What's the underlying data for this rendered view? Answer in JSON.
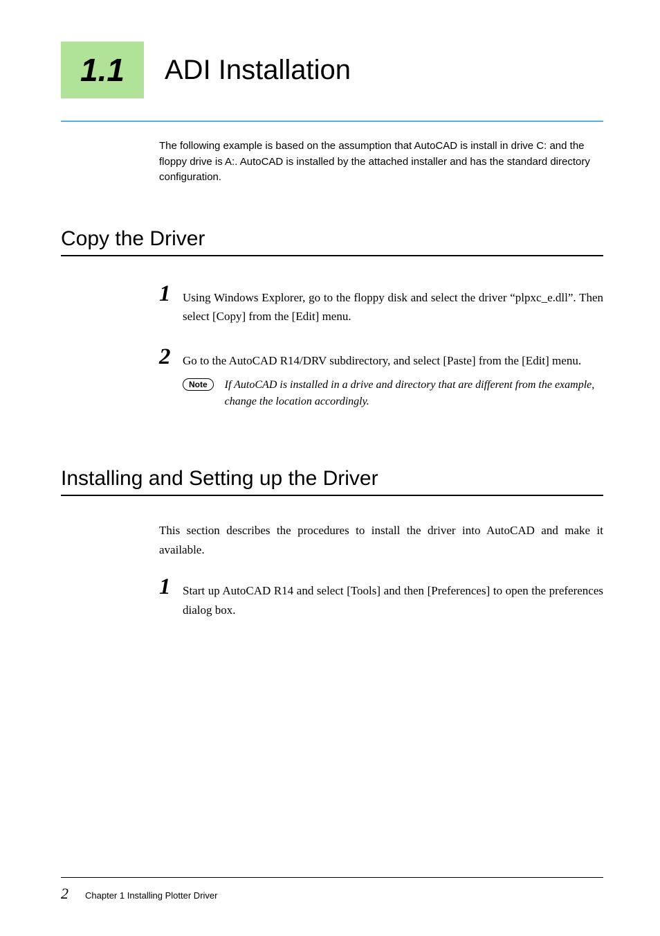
{
  "section_number": "1.1",
  "page_title": "ADI Installation",
  "intro": "The following example is based on the assumption that AutoCAD is install in drive C: and the floppy drive is A:. AutoCAD is installed by the attached installer and has the standard directory configuration.",
  "copy_section": {
    "heading": "Copy the Driver",
    "steps": [
      {
        "num": "1",
        "text": "Using Windows Explorer, go to the floppy disk and select the driver “plpxc_e.dll”. Then select [Copy] from the [Edit] menu."
      },
      {
        "num": "2",
        "text": "Go to the AutoCAD R14/DRV subdirectory, and select [Paste] from the [Edit] menu."
      }
    ],
    "note_label": "Note",
    "note_text": "If AutoCAD is installed in a drive and directory that are different from the example, change the location accordingly."
  },
  "install_section": {
    "heading": "Installing and Setting up the Driver",
    "intro": "This section describes the procedures to install the driver into AutoCAD and make it available.",
    "steps": [
      {
        "num": "1",
        "text": "Start up AutoCAD R14 and select [Tools] and then [Preferences] to open the preferences dialog box."
      }
    ]
  },
  "footer": {
    "page_number": "2",
    "chapter_label": "Chapter 1  Installing Plotter Driver"
  }
}
